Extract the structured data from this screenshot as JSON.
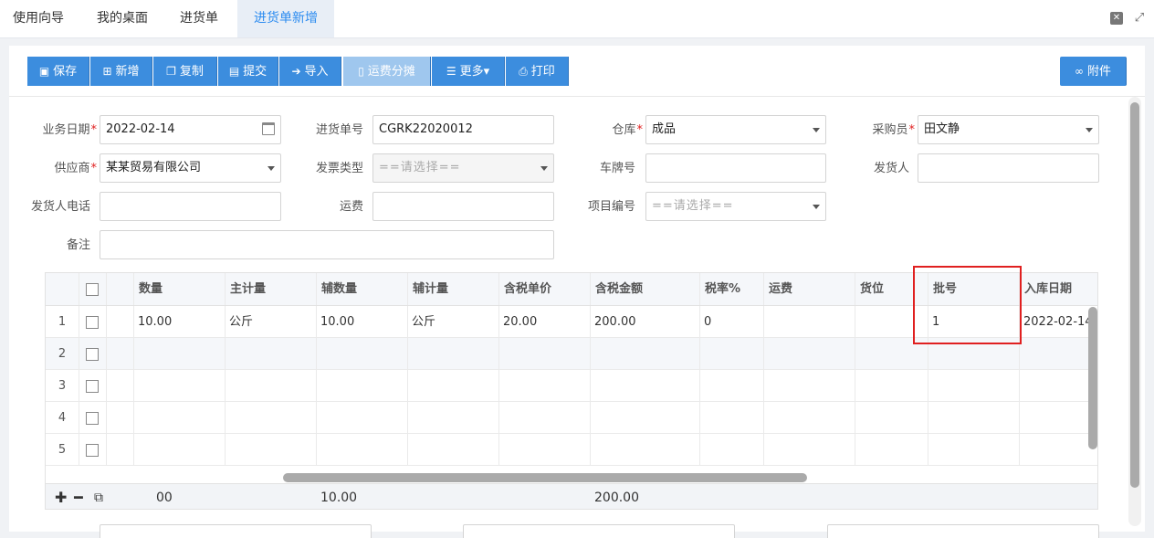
{
  "tabs": [
    {
      "label": "使用向导"
    },
    {
      "label": "我的桌面"
    },
    {
      "label": "进货单"
    },
    {
      "label": "进货单新增"
    }
  ],
  "toolbar": {
    "save": "保存",
    "new": "新增",
    "copy": "复制",
    "submit": "提交",
    "import": "导入",
    "freight_split": "运费分摊",
    "more": "更多",
    "print": "打印",
    "attachment": "附件"
  },
  "form": {
    "biz_date_label": "业务日期",
    "biz_date_value": "2022-02-14",
    "doc_no_label": "进货单号",
    "doc_no_value": "CGRK22020012",
    "warehouse_label": "仓库",
    "warehouse_value": "成品",
    "buyer_label": "采购员",
    "buyer_value": "田文静",
    "supplier_label": "供应商",
    "supplier_value": "某某贸易有限公司",
    "invoice_type_label": "发票类型",
    "invoice_type_placeholder": "==请选择==",
    "plate_label": "车牌号",
    "plate_value": "",
    "shipper_label": "发货人",
    "shipper_value": "",
    "shipper_phone_label": "发货人电话",
    "shipper_phone_value": "",
    "freight_label": "运费",
    "freight_value": "",
    "project_label": "项目编号",
    "project_placeholder": "==请选择==",
    "remark_label": "备注",
    "remark_value": ""
  },
  "grid": {
    "columns": [
      "数量",
      "主计量",
      "辅数量",
      "辅计量",
      "含税单价",
      "含税金额",
      "税率%",
      "运费",
      "货位",
      "批号",
      "入库日期"
    ],
    "rows": [
      {
        "num": "1",
        "qty": "10.00",
        "unit": "公斤",
        "aux_qty": "10.00",
        "aux_unit": "公斤",
        "price": "20.00",
        "amount": "200.00",
        "tax": "0",
        "freight": "",
        "location": "",
        "batch": "1",
        "in_date": "2022-02-14"
      },
      {
        "num": "2"
      },
      {
        "num": "3"
      },
      {
        "num": "4"
      },
      {
        "num": "5"
      }
    ],
    "footer": {
      "qty_total": "00",
      "aux_total": "10.00",
      "amount_total": "200.00"
    }
  },
  "colors": {
    "primary": "#3c8dde",
    "disabled": "#9fc7ee",
    "highlight": "#e02020",
    "active_tab": "#2d8cf0"
  }
}
